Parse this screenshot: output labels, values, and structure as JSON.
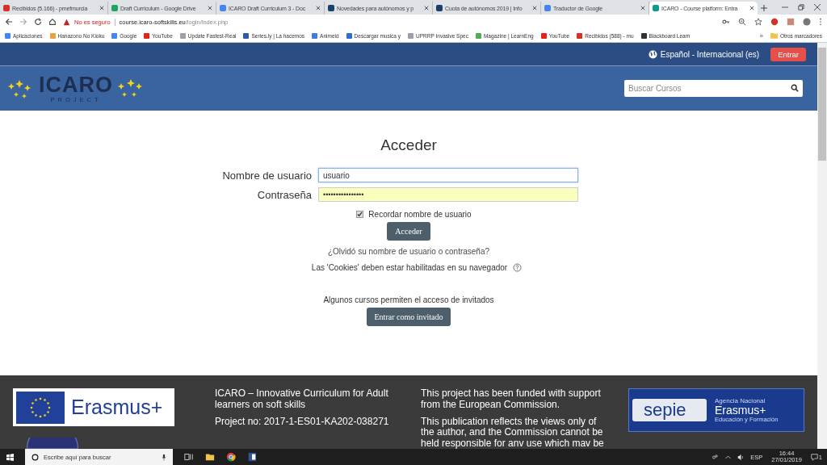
{
  "browser": {
    "tabs": [
      {
        "title": "Recibidos (5.166) - pmefmurcia",
        "selected": false,
        "color": "#d93025"
      },
      {
        "title": "Draft Curriculum - Google Drive",
        "selected": false,
        "color": "#1fa463"
      },
      {
        "title": "ICARO Draft Curriculum 3 - Doc",
        "selected": false,
        "color": "#4285f4"
      },
      {
        "title": "Novedades para autónomos y p",
        "selected": false,
        "color": "#1b3f6b"
      },
      {
        "title": "Cuota de autónomos 2019 | Info",
        "selected": false,
        "color": "#1b3f6b"
      },
      {
        "title": "Traductor de Google",
        "selected": false,
        "color": "#4285f4"
      },
      {
        "title": "ICARO - Course platform: Entra",
        "selected": true,
        "color": "#0f9d8a"
      }
    ],
    "security": "No es seguro",
    "url_host": "course.icaro-softskills.eu",
    "url_path": "/login/index.php",
    "bookmarks": [
      {
        "title": "Aplicaciones",
        "color": "#4285f4"
      },
      {
        "title": "Hanazono No Kioku",
        "color": "#e8a33d"
      },
      {
        "title": "Google",
        "color": "#4285f4"
      },
      {
        "title": "YouTube",
        "color": "#e62117"
      },
      {
        "title": "Update Fastest-Real",
        "color": "#9aa0a6"
      },
      {
        "title": "Series.ly | La hacemos",
        "color": "#2b5aa8"
      },
      {
        "title": "Animeid",
        "color": "#3b7dd8"
      },
      {
        "title": "Descargar musica y",
        "color": "#2b6fd6"
      },
      {
        "title": "UPRRP Invasive Spec",
        "color": "#9aa0a6"
      },
      {
        "title": "Magazine | LearnEng",
        "color": "#4caf50"
      },
      {
        "title": "YouTube",
        "color": "#e62117"
      },
      {
        "title": "Recibidos (588) - mu",
        "color": "#d93025"
      },
      {
        "title": "Blackboard Learn",
        "color": "#333333"
      }
    ],
    "more_bookmarks": "»",
    "other_bookmarks": "Otros marcadores"
  },
  "site": {
    "language": "Español - Internacional (es)",
    "login_button": "Entrar",
    "logo_title": "ICARO",
    "logo_subtitle": "PROJECT",
    "search_placeholder": "Buscar Cursos"
  },
  "login": {
    "title": "Acceder",
    "username_label": "Nombre de usuario",
    "username_value": "usuario",
    "password_label": "Contraseña",
    "password_value": "••••••••••••••••",
    "remember": {
      "label": "Recordar nombre de usuario",
      "checked": true
    },
    "submit": "Acceder",
    "forgot": "¿Olvidó su nombre de usuario o contraseña?",
    "cookies": "Las 'Cookies' deben estar habilitadas en su navegador",
    "guest_note": "Algunos cursos permiten el acceso de invitados",
    "guest_button": "Entrar como invitado"
  },
  "footer": {
    "erasmus_logo": "Erasmus+",
    "project_title": "ICARO – Innovative Curriculum for Adult learners on soft skills",
    "project_no": "Project no: 2017-1-ES01-KA202-038271",
    "funded": "This project has been funded with support from the European Commission.",
    "disclaimer": "This publication reflects the views only of the author, and the Commission cannot be held responsible for anv use which mav be",
    "sepie": "sepie",
    "agency": "Agencia Nacional",
    "agency_erasmus": "Erasmus+",
    "agency_sub": "Educación y Formación"
  },
  "taskbar": {
    "search_placeholder": "Escribe aquí para buscar",
    "language": "ESP",
    "time": "16:44",
    "date": "27/01/2019",
    "notifications": "1"
  }
}
